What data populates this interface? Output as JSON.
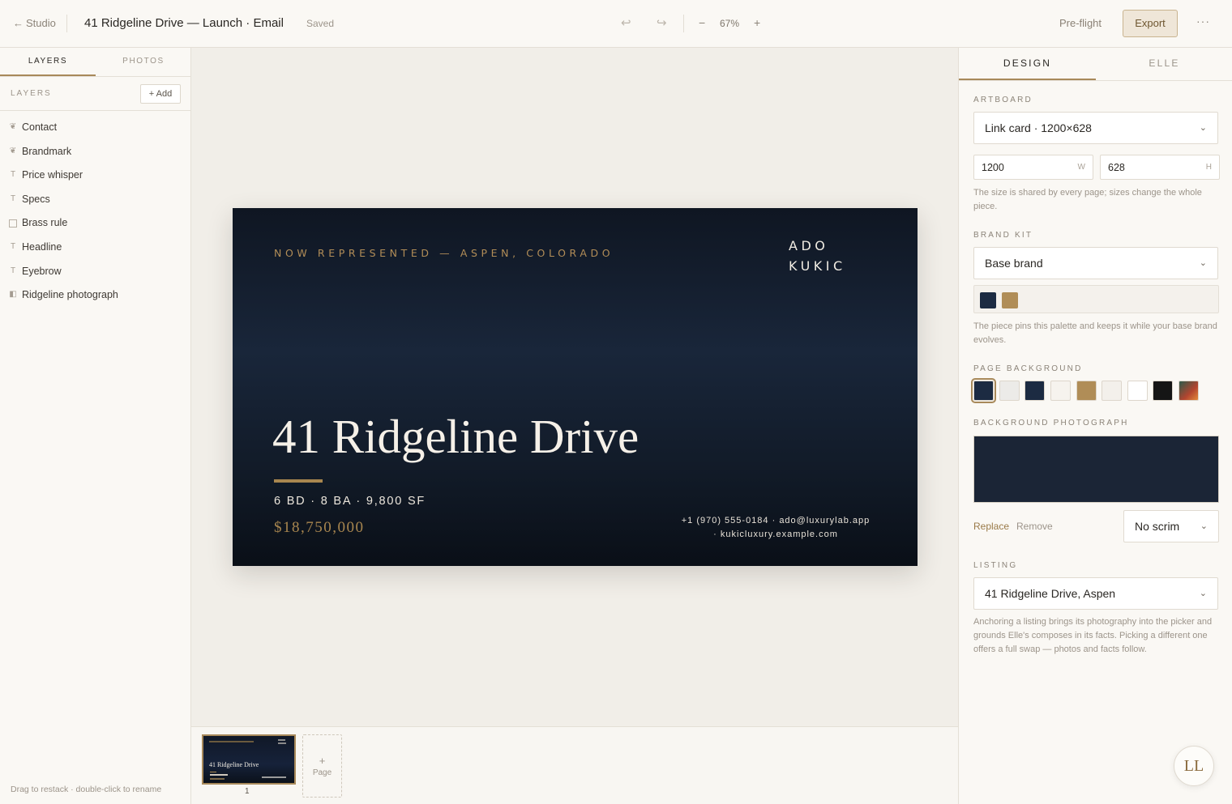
{
  "topbar": {
    "back_label": "Studio",
    "doc_title": "41 Ridgeline Drive — Launch · Email",
    "status": "Saved",
    "undo": "↩",
    "redo": "↪",
    "zoom_minus": "−",
    "zoom_level": "67%",
    "zoom_plus": "+",
    "preflight_label": "Pre-flight",
    "export_label": "Export",
    "more_label": "···"
  },
  "left_panel": {
    "tabs": [
      "LAYERS",
      "PHOTOS"
    ],
    "active_tab": "LAYERS",
    "section_label": "LAYERS",
    "add_label": "+ Add",
    "layers": [
      {
        "icon": "brandmark-icon",
        "glyph": "❦",
        "label": "Contact"
      },
      {
        "icon": "brandmark-icon",
        "glyph": "❦",
        "label": "Brandmark"
      },
      {
        "icon": "text-icon",
        "glyph": "T",
        "label": "Price whisper"
      },
      {
        "icon": "text-icon",
        "glyph": "T",
        "label": "Specs"
      },
      {
        "icon": "shape-icon",
        "glyph": "",
        "label": "Brass rule"
      },
      {
        "icon": "text-icon",
        "glyph": "T",
        "label": "Headline"
      },
      {
        "icon": "text-icon",
        "glyph": "T",
        "label": "Eyebrow"
      },
      {
        "icon": "image-icon",
        "glyph": "◧",
        "label": "Ridgeline photograph"
      }
    ],
    "footer_hint": "Drag to restack · double-click to rename"
  },
  "card": {
    "eyebrow": "NOW REPRESENTED — ASPEN, COLORADO",
    "brand_line1": "ADO",
    "brand_line2": "KUKIC",
    "headline": "41 Ridgeline Drive",
    "specs": "6 BD · 8 BA · 9,800 SF",
    "price": "$18,750,000",
    "contact_line1": "+1 (970) 555-0184 · ado@luxurylab.app",
    "contact_line2": "· kukicluxury.example.com"
  },
  "pages": {
    "thumb_title": "41 Ridgeline Drive",
    "page_number": "1",
    "add_plus": "+",
    "add_label": "Page"
  },
  "right_panel": {
    "tabs": [
      "DESIGN",
      "ELLE"
    ],
    "active_tab": "DESIGN",
    "artboard": {
      "label": "ARTBOARD",
      "preset": "Link card · 1200×628",
      "width": "1200",
      "width_unit": "W",
      "height": "628",
      "height_unit": "H",
      "help": "The size is shared by every page; sizes change the whole piece."
    },
    "brand_kit": {
      "label": "BRAND KIT",
      "value": "Base brand",
      "palette": [
        "#1c2b42",
        "#b08d57"
      ],
      "help": "The piece pins this palette and keeps it while your base brand evolves."
    },
    "page_background": {
      "label": "PAGE BACKGROUND",
      "swatches": [
        "#1c2b42",
        "#ecebe8",
        "#1c2b42",
        "#f6f3ee",
        "#b08d57",
        "#f3f0eb",
        "#ffffff",
        "#151515",
        "gradient"
      ],
      "selected_index": 0
    },
    "background_photo": {
      "label": "BACKGROUND PHOTOGRAPH",
      "replace_label": "Replace",
      "remove_label": "Remove",
      "scrim": "No scrim"
    },
    "listing": {
      "label": "LISTING",
      "value": "41 Ridgeline Drive, Aspen",
      "help": "Anchoring a listing brings its photography into the picker and grounds Elle's composes in its facts. Picking a different one offers a full swap — photos and facts follow."
    }
  },
  "assistant": {
    "badge": "LL"
  },
  "colors": {
    "accent_brass": "#a8895a",
    "navy": "#1c2b42",
    "panel_bg": "#faf8f4",
    "canvas_bg": "#f1eee8"
  }
}
